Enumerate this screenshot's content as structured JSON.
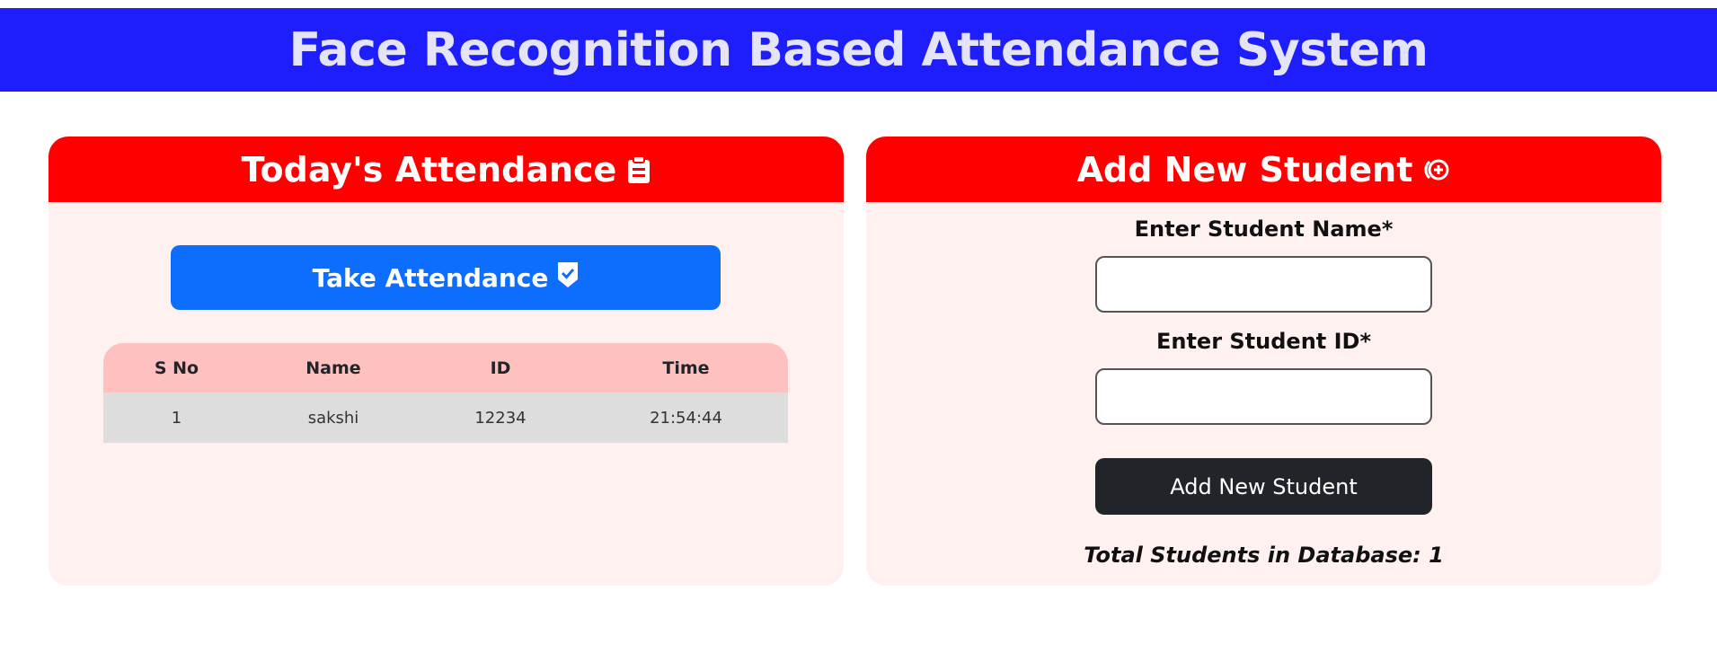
{
  "header": {
    "title": "Face Recognition Based Attendance System"
  },
  "attendance": {
    "title": "Today's Attendance",
    "title_icon": "clipboard-icon",
    "take_button_label": "Take Attendance",
    "take_button_icon": "shield-check-icon",
    "columns": [
      "S No",
      "Name",
      "ID",
      "Time"
    ],
    "rows": [
      [
        "1",
        "sakshi",
        "12234",
        "21:54:44"
      ]
    ]
  },
  "add_student": {
    "title": "Add New Student",
    "title_icon": "add-circle-icon",
    "name_label": "Enter Student Name*",
    "name_value": "",
    "id_label": "Enter Student ID*",
    "id_value": "",
    "submit_label": "Add New Student",
    "total_text": "Total Students in Database: 1"
  },
  "colors": {
    "header_bg": "#1e1efc",
    "card_header_bg": "#ff0000",
    "card_bg": "#fef1f0",
    "primary_button": "#0d6efd",
    "dark_button": "#212529",
    "table_head_bg": "#ffc0c0",
    "table_row_bg": "#dddddd"
  }
}
